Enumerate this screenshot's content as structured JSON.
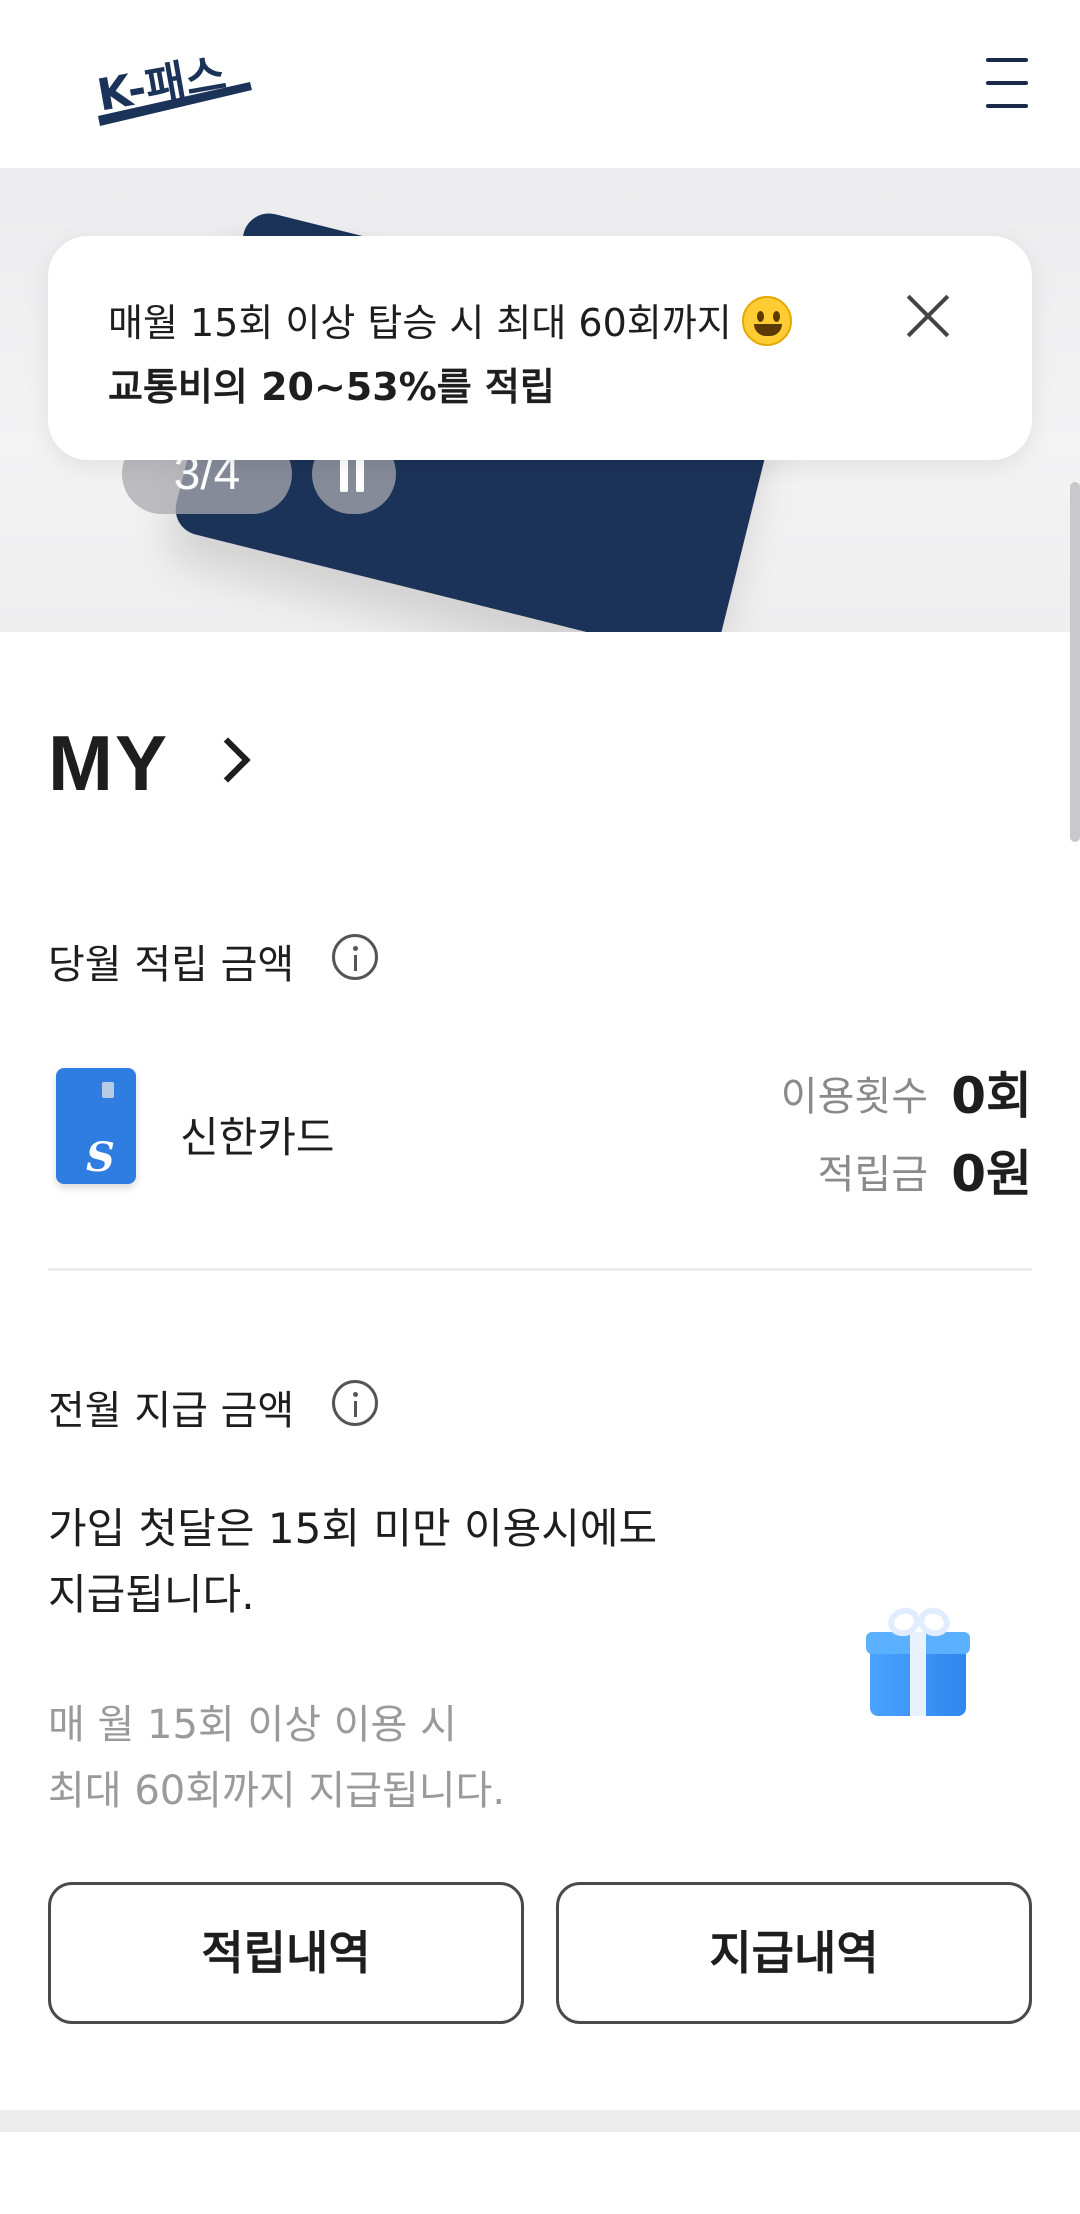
{
  "header": {
    "logo_text": "K-패스",
    "menu_icon": "hamburger-menu-icon"
  },
  "banner": {
    "counter": "3/4",
    "pause_icon": "pause-icon"
  },
  "toast": {
    "line1": "매월 15회 이상 탑승 시 최대 60회까지",
    "emoji": "grinning-face-icon",
    "line2": "교통비의 20~53%를 적립",
    "close_icon": "close-icon"
  },
  "my": {
    "title": "MY"
  },
  "monthly": {
    "label": "당월 적립 금액",
    "card_name": "신한카드",
    "usage_label": "이용횟수",
    "usage_value": "0회",
    "points_label": "적립금",
    "points_value": "0원"
  },
  "previous": {
    "label": "전월 지급 금액",
    "body_line1": "가입 첫달은 15회 미만 이용시에도",
    "body_line2": "지급됩니다.",
    "note_line1": "매 월 15회 이상 이용 시",
    "note_line2": "최대 60회까지 지급됩니다."
  },
  "buttons": {
    "accrual_history": "적립내역",
    "payment_history": "지급내역"
  },
  "colors": {
    "brand_navy": "#1b3358",
    "card_blue": "#2f7de0",
    "muted_text": "#8a8a8a"
  }
}
